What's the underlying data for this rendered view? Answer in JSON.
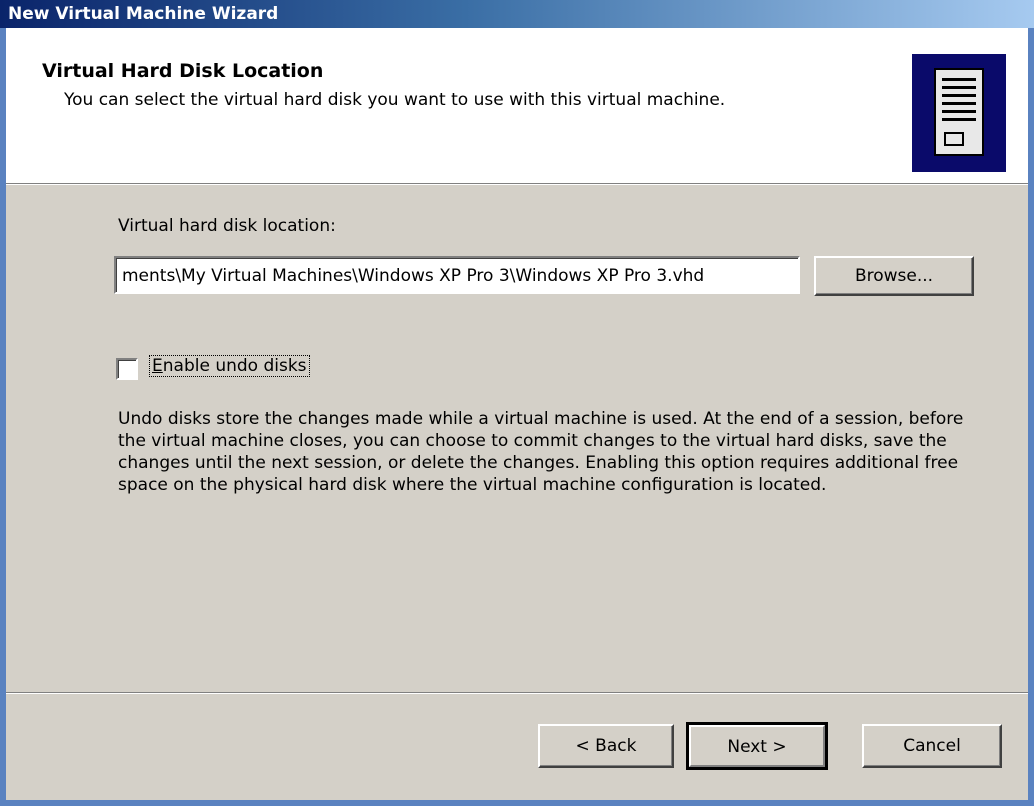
{
  "window": {
    "title": "New Virtual Machine Wizard"
  },
  "header": {
    "title": "Virtual Hard Disk Location",
    "subtitle": "You can select the virtual hard disk you want to use with this virtual machine.",
    "icon": "server-tower-icon"
  },
  "form": {
    "location_label": "Virtual hard disk location:",
    "location_value": "ments\\My Virtual Machines\\Windows XP Pro 3\\Windows XP Pro 3.vhd",
    "browse_label": "Browse...",
    "undo_checkbox": {
      "label_first": "E",
      "label_rest": "nable undo disks",
      "checked": false
    },
    "description": "Undo disks store the changes made while a virtual machine is used. At the end of a session, before the virtual machine closes, you can choose to commit changes to the virtual hard disks, save the changes until the next session, or delete the changes. Enabling this option requires additional free space on the physical hard disk where the virtual machine configuration is located."
  },
  "footer": {
    "back_label": "< Back",
    "next_label": "Next >",
    "cancel_label": "Cancel"
  }
}
